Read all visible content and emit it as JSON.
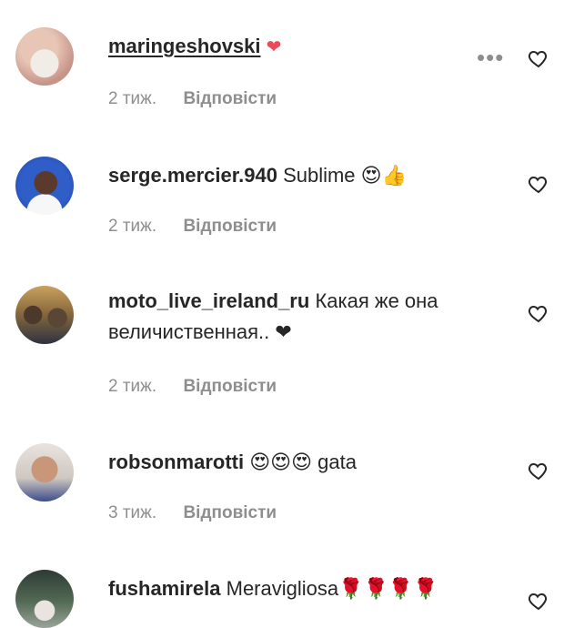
{
  "comments": [
    {
      "username": "maringeshovski",
      "text": "❤",
      "time": "2 тиж.",
      "reply": "Відповісти"
    },
    {
      "username": "serge.mercier.940",
      "text": "Sublime 😍👍",
      "time": "2 тиж.",
      "reply": "Відповісти"
    },
    {
      "username": "moto_live_ireland_ru",
      "text": "Какая же она величиственная.. ❤",
      "time": "2 тиж.",
      "reply": "Відповісти"
    },
    {
      "username": "robsonmarotti",
      "text": "😍😍😍 gata",
      "time": "3 тиж.",
      "reply": "Відповісти"
    },
    {
      "username": "fushamirela",
      "text": "Meravigliosa🌹🌹🌹🌹",
      "time": "",
      "reply": ""
    }
  ],
  "icons": {
    "heart": "heart-outline-icon",
    "more": "more-options-icon"
  }
}
